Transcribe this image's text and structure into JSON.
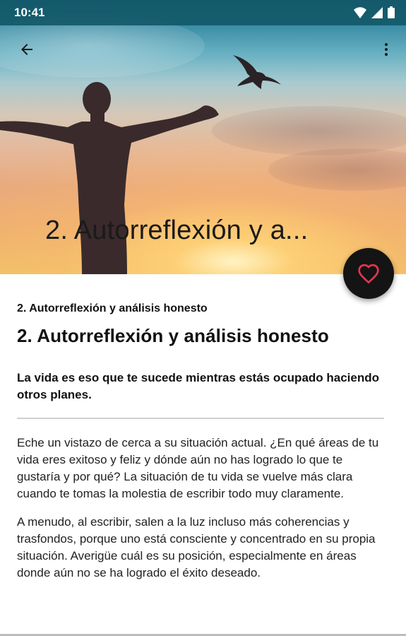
{
  "status_bar": {
    "time": "10:41"
  },
  "toolbar": {
    "back_icon": "arrow-back-icon",
    "menu_icon": "more-vert-icon"
  },
  "hero": {
    "title": "2. Autorreflexión y a..."
  },
  "fab": {
    "icon": "heart-outline-icon",
    "color": "#e8344e"
  },
  "article": {
    "breadcrumb": "2. Autorreflexión y análisis honesto",
    "title": "2. Autorreflexión y análisis honesto",
    "quote": "La vida es eso que te sucede mientras estás ocupado haciendo otros planes.",
    "paragraphs": [
      "Eche un vistazo de cerca a su situación actual. ¿En qué áreas de tu vida eres exitoso y feliz y dónde aún no has logrado lo que te gustaría y por qué? La situación de tu vida se vuelve más clara cuando te tomas la molestia de escribir todo muy claramente.",
      "A menudo, al escribir, salen a la luz incluso más coherencias y trasfondos, porque uno está consciente y concentrado en su propia situación. Averigüe cuál es su posición, especialmente en áreas donde aún no se ha logrado el éxito deseado."
    ]
  }
}
